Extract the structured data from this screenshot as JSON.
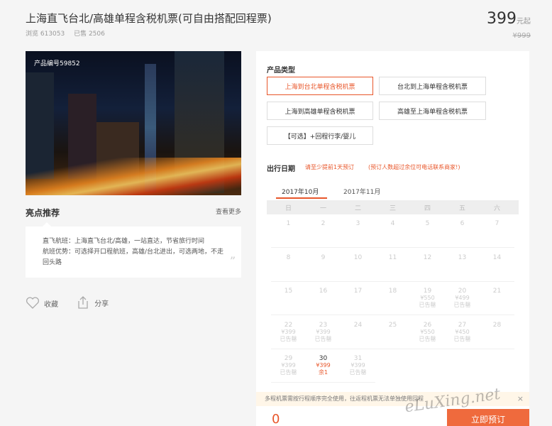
{
  "product": {
    "title": "上海直飞台北/高雄单程含税机票(可自由搭配回程票)",
    "views": "浏览 613053",
    "sold": "已售 2506",
    "price": "399",
    "price_unit": "元起",
    "old_price": "¥999",
    "code": "产品编号59852"
  },
  "highlights": {
    "title": "亮点推荐",
    "more": "查看更多",
    "line1": "直飞航班：上海直飞台北/高雄，一站直达，节省旅行时间",
    "line2": "航班优势：可选择开口程航班，高雄/台北进出，可选两地，不走回头路",
    "quote": "”"
  },
  "actions": {
    "favorite": "收藏",
    "share": "分享"
  },
  "panel": {
    "type_label": "产品类型",
    "options": [
      "上海到台北单程含税机票",
      "台北到上海单程含税机票",
      "上海到高雄单程含税机票",
      "高雄至上海单程含税机票",
      "【可选】+回程行李/婴儿"
    ],
    "date_label": "出行日期",
    "note1": "请至少提前1天预订",
    "note2": "(预订人数超过余位可电话联系商家!)",
    "months": [
      "2017年10月",
      "2017年11月"
    ],
    "weekdays": [
      "日",
      "一",
      "二",
      "三",
      "四",
      "五",
      "六"
    ],
    "days": [
      {
        "d": "1"
      },
      {
        "d": "2"
      },
      {
        "d": "3"
      },
      {
        "d": "4"
      },
      {
        "d": "5"
      },
      {
        "d": "6"
      },
      {
        "d": "7"
      },
      {
        "d": "8"
      },
      {
        "d": "9"
      },
      {
        "d": "10"
      },
      {
        "d": "11"
      },
      {
        "d": "12"
      },
      {
        "d": "13"
      },
      {
        "d": "14"
      },
      {
        "d": "15"
      },
      {
        "d": "16"
      },
      {
        "d": "17"
      },
      {
        "d": "18"
      },
      {
        "d": "19",
        "p": "¥550",
        "s": "已告罄"
      },
      {
        "d": "20",
        "p": "¥499",
        "s": "已告罄"
      },
      {
        "d": "21"
      },
      {
        "d": "22",
        "p": "¥399",
        "s": "已告罄"
      },
      {
        "d": "23",
        "p": "¥399",
        "s": "已告罄"
      },
      {
        "d": "24"
      },
      {
        "d": "25"
      },
      {
        "d": "26",
        "p": "¥550",
        "s": "已告罄"
      },
      {
        "d": "27",
        "p": "¥450",
        "s": "已告罄"
      },
      {
        "d": "28"
      },
      {
        "d": "29",
        "p": "¥399",
        "s": "已告罄"
      },
      {
        "d": "30",
        "p": "¥399",
        "s": "余1",
        "avail": true
      },
      {
        "d": "31",
        "p": "¥399",
        "s": "已告罄"
      }
    ],
    "warning": "多程机票需按行程顺序完全使用，往返程机票无法单独使用回程",
    "close": "×",
    "count": "0",
    "buy": "立即预订"
  },
  "watermark": "eLuXing.net"
}
